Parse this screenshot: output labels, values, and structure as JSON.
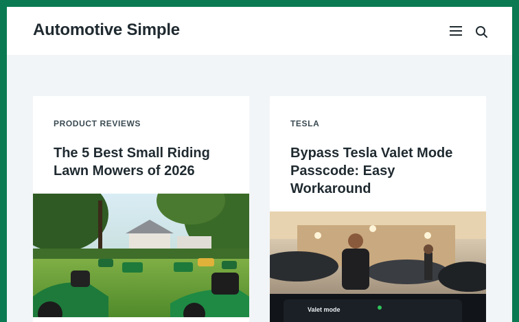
{
  "site": {
    "title": "Automotive Simple"
  },
  "header": {
    "menu_icon": "menu-icon",
    "search_icon": "search-icon"
  },
  "posts": [
    {
      "category": "PRODUCT REVIEWS",
      "title": "The 5 Best Small Riding Lawn Mowers of 2026",
      "image_icon": "lawn-mowers-photo"
    },
    {
      "category": "TESLA",
      "title": "Bypass Tesla Valet Mode Passcode: Easy Workaround",
      "image_icon": "tesla-valet-photo",
      "image_caption": "Valet mode"
    }
  ],
  "colors": {
    "accent_border": "#0b7a52",
    "page_background": "#f2f5f7",
    "card_background": "#ffffff",
    "text": "#1f2a30"
  }
}
